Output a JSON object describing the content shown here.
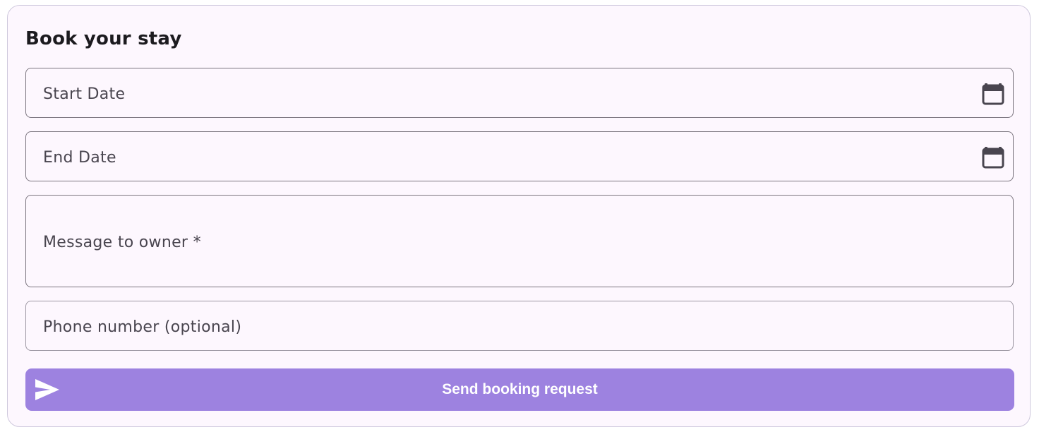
{
  "form": {
    "title": "Book your stay",
    "fields": {
      "start_date": {
        "label": "Start Date",
        "icon": "calendar-icon"
      },
      "end_date": {
        "label": "End Date",
        "icon": "calendar-icon"
      },
      "message": {
        "label": "Message to owner *"
      },
      "phone": {
        "label": "Phone number (optional)"
      }
    },
    "submit": {
      "label": "Send booking request",
      "icon": "send-icon"
    }
  },
  "colors": {
    "card_background": "#fdf7fe",
    "button_background": "#9d82e0",
    "text": "#1c1b1f",
    "label": "#49454f",
    "outline": "#7b757f"
  }
}
